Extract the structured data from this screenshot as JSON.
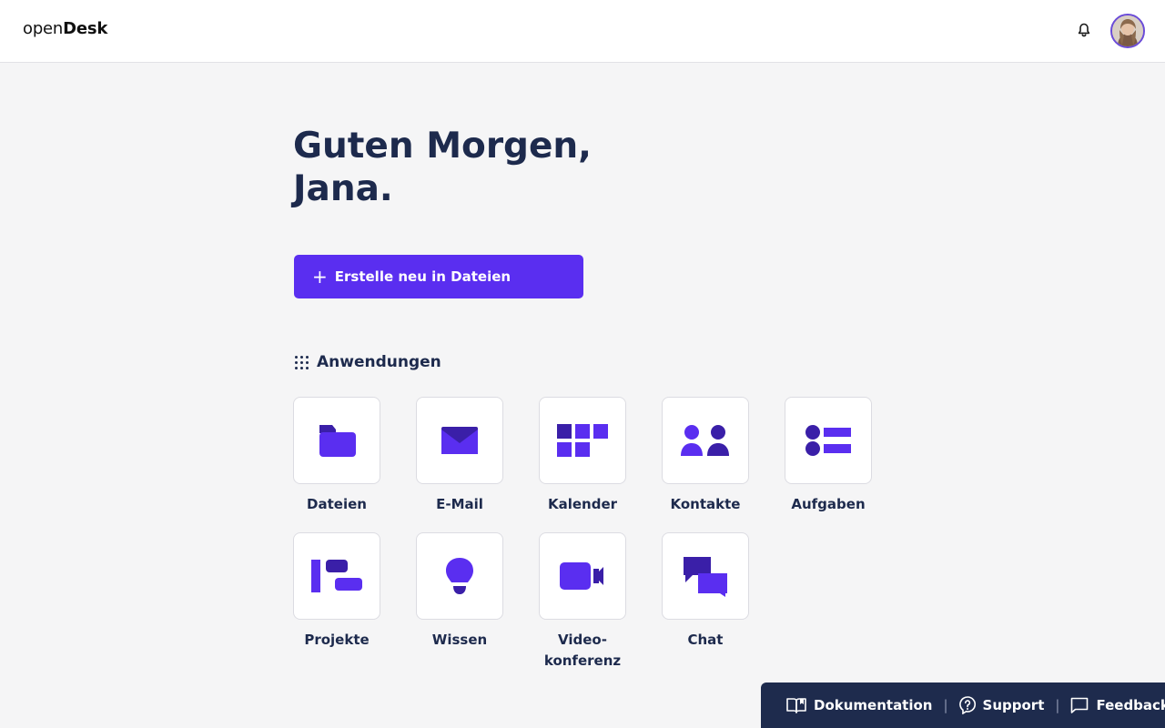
{
  "header": {
    "logo_light": "open",
    "logo_bold": "Desk",
    "notification_icon": "bell-icon",
    "avatar_icon": "user-avatar"
  },
  "greeting": {
    "line1": "Guten Morgen,",
    "line2": "Jana."
  },
  "create_button": {
    "plus": "+",
    "label": "Erstelle neu in Dateien"
  },
  "apps_section": {
    "title": "Anwendungen",
    "items": [
      {
        "label": "Dateien",
        "icon": "folder-icon"
      },
      {
        "label": "E-Mail",
        "icon": "mail-icon"
      },
      {
        "label": "Kalender",
        "icon": "calendar-icon"
      },
      {
        "label": "Kontakte",
        "icon": "contacts-icon"
      },
      {
        "label": "Aufgaben",
        "icon": "tasks-icon"
      },
      {
        "label": "Projekte",
        "icon": "projects-icon"
      },
      {
        "label": "Wissen",
        "icon": "lightbulb-icon"
      },
      {
        "label": "Video-\nkonferenz",
        "icon": "video-icon"
      },
      {
        "label": "Chat",
        "icon": "chat-icon"
      }
    ]
  },
  "footer": {
    "docs": "Dokumentation",
    "support": "Support",
    "feedback": "Feedback",
    "separator": "|"
  },
  "colors": {
    "accent": "#5a2ef0",
    "accent_dark": "#3a1fa8",
    "text": "#1d2a4d",
    "footer_bg": "#1e2b4d"
  }
}
